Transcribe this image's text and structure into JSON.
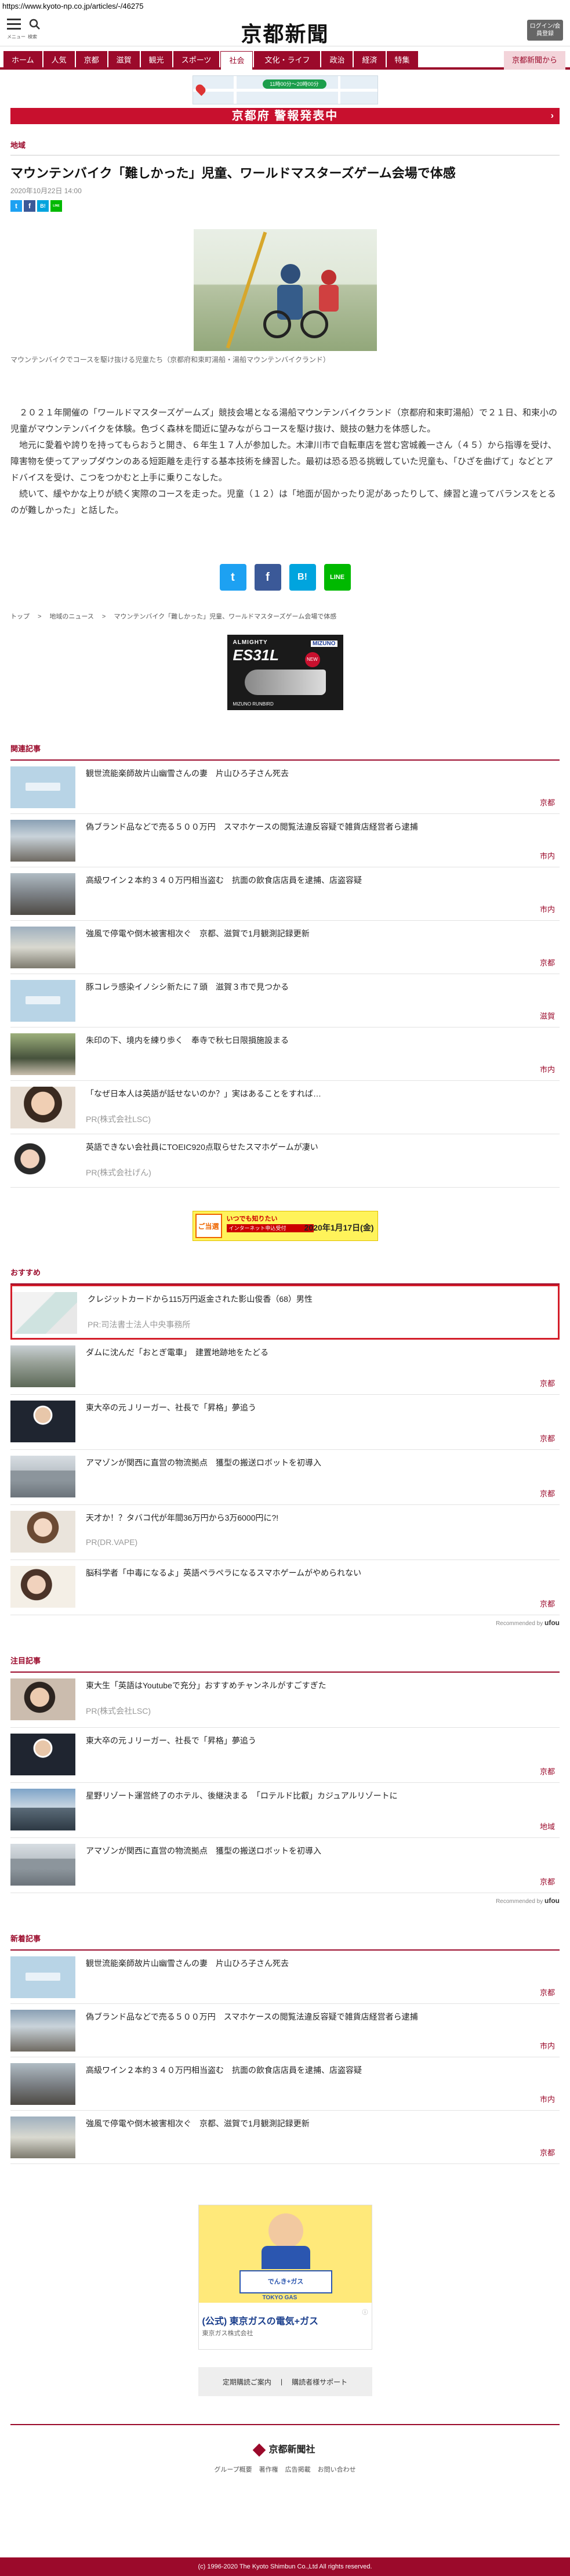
{
  "browser": {
    "url": "https://www.kyoto-np.co.jp/articles/-/46275"
  },
  "header": {
    "menu_label": "メニュー",
    "search_label": "検索",
    "logo": "京都新聞",
    "login_button": "ログイン/会員登録"
  },
  "nav": {
    "items": [
      "ホーム",
      "人気",
      "京都",
      "滋賀",
      "観光",
      "スポーツ",
      "社会",
      "文化・ライフ",
      "政治",
      "経済",
      "特集",
      "京都新聞から"
    ],
    "active_index": 6
  },
  "map_banner": {
    "pill_text": "11時00分〜20時00分"
  },
  "alert": {
    "text": "京都府 警報発表中",
    "arrow": "›"
  },
  "article": {
    "category": "地域",
    "title": "マウンテンバイク「難しかった」児童、ワールドマスターズゲーム会場で体感",
    "date": "2020年10月22日 14:00",
    "caption": "マウンテンバイクでコースを駆け抜ける児童たち（京都府和束町湯船・湯船マウンテンバイクランド）",
    "paragraphs": [
      "２０２１年開催の「ワールドマスターズゲームズ」競技会場となる湯船マウンテンバイクランド（京都府和束町湯船）で２１日、和束小の児童がマウンテンバイクを体験。色づく森林を間近に望みながらコースを駆け抜け、競技の魅力を体感した。",
      "地元に愛着や誇りを持ってもらおうと開き、６年生１７人が参加した。木津川市で自転車店を営む宮城義一さん（４５）から指導を受け、障害物を使ってアップダウンのある短距離を走行する基本技術を練習した。最初は恐る恐る挑戦していた児童も、「ひざを曲げて」などとアドバイスを受け、こつをつかむと上手に乗りこなした。",
      "続いて、緩やかな上りが続く実際のコースを走った。児童（１２）は「地面が固かったり泥があったりして、練習と違ってバランスをとるのが難しかった」と話した。"
    ],
    "breadcrumb": [
      "トップ",
      "地域のニュース",
      "マウンテンバイク「難しかった」児童、ワールドマスターズゲーム会場で体感"
    ]
  },
  "share": {
    "twitter": "t",
    "facebook": "f",
    "hatena": "B!",
    "line": "LINE"
  },
  "ad_shoe": {
    "brand": "ALMIGHTY",
    "model": "ES31L",
    "maker": "MIZUNO",
    "badge": "NEW",
    "slogan": "MIZUNO RUNBIRD"
  },
  "related": {
    "title": "関連記事",
    "items": [
      {
        "title": "観世流能楽師故片山幽雪さんの妻　片山ひろ子さん死去",
        "tag": "京都",
        "thumb": "logo"
      },
      {
        "title": "偽ブランド品などで売る５００万円　スマホケースの閲覧法違反容疑で雑貨店経営者ら逮捕",
        "tag": "市内",
        "thumb": "city"
      },
      {
        "title": "高級ワイン２本約３４０万円相当盗む　抗面の飲食店店員を逮捕、店盗容疑",
        "tag": "市内",
        "thumb": "city2"
      },
      {
        "title": "強風で停電や倒木被害相次ぐ　京都、滋賀で1月観測記録更新",
        "tag": "京都",
        "thumb": "city3"
      },
      {
        "title": "豚コレラ感染イノシシ新たに７頭　滋賀３市で見つかる",
        "tag": "滋賀",
        "thumb": "logo"
      },
      {
        "title": "朱印の下、境内を練り歩く　奉寺で秋七日限損施設まる",
        "tag": "市内",
        "thumb": "people"
      },
      {
        "title": "「なぜ日本人は英語が話せないのか？」実はあることをすれば…",
        "sponsor": "PR(株式会社LSC)",
        "thumb": "face"
      },
      {
        "title": "英語できない会社員にTOEIC920点取らせたスマホゲームが凄い",
        "sponsor": "PR(株式会社げん)",
        "thumb": "face2"
      }
    ]
  },
  "ad_yellow": {
    "line1": "ご当選",
    "line2": "いつでも知りたい",
    "line3": "インターネット申込受付",
    "date": "2020年1月17日(金)"
  },
  "recommend": {
    "title": "おすすめ",
    "items": [
      {
        "title": "クレジットカードから115万円返金された影山俊香（68）男性",
        "sponsor": "PR:司法書士法人中央事務所",
        "thumb": "card",
        "highlight": true
      },
      {
        "title": "ダムに沈んだ「おとぎ電車」　建置地跡地をたどる",
        "tag": "京都",
        "thumb": "dam"
      },
      {
        "title": "東大卒の元Ｊリーガー、社長で「昇格」夢追う",
        "tag": "京都",
        "thumb": "man"
      },
      {
        "title": "アマゾンが関西に直営の物流拠点　獲型の搬送ロボットを初導入",
        "tag": "京都",
        "thumb": "warehouse"
      },
      {
        "title": "天才か！？タバコ代が年間36万円から3万6000円に?!",
        "sponsor": "PR(DR.VAPE)",
        "thumb": "woman"
      },
      {
        "title": "脳科学者「中毒になるよ」英語ペラペラになるスマホゲームがやめられない",
        "tag": "京都",
        "thumb": "face3"
      }
    ],
    "recommended_by": "Recommended by",
    "brand": "ufou"
  },
  "featured": {
    "title": "注目記事",
    "items": [
      {
        "title": "東大生「英語はYoutubeで充分」おすすめチャンネルがすごすぎた",
        "sponsor": "PR(株式会社LSC)",
        "thumb": "face4"
      },
      {
        "title": "東大卒の元Ｊリーガー、社長で「昇格」夢追う",
        "tag": "京都",
        "thumb": "man"
      },
      {
        "title": "星野リゾート運営終了のホテル、後継決まる　「ロテルド比叡」カジュアルリゾートに",
        "tag": "地域",
        "thumb": "hotel"
      },
      {
        "title": "アマゾンが関西に直営の物流拠点　獲型の搬送ロボットを初導入",
        "tag": "京都",
        "thumb": "warehouse"
      }
    ],
    "recommended_by": "Recommended by",
    "brand": "ufou"
  },
  "latest": {
    "title": "新着記事",
    "items": [
      {
        "title": "観世流能楽師故片山幽雪さんの妻　片山ひろ子さん死去",
        "tag": "京都",
        "thumb": "logo"
      },
      {
        "title": "偽ブランド品などで売る５００万円　スマホケースの閲覧法違反容疑で雑貨店経営者ら逮捕",
        "tag": "市内",
        "thumb": "city"
      },
      {
        "title": "高級ワイン２本約３４０万円相当盗む　抗面の飲食店店員を逮捕、店盗容疑",
        "tag": "市内",
        "thumb": "city2"
      },
      {
        "title": "強風で停電や倒木被害相次ぐ　京都、滋賀で1月観測記録更新",
        "tag": "京都",
        "thumb": "city3"
      }
    ]
  },
  "gas_ad": {
    "headline": "(公式) 東京ガスの電気+ガス",
    "sub": "東京ガス株式会社",
    "badge": "でんき+ガス",
    "brand": "TOKYO GAS"
  },
  "footer": {
    "links": [
      "定期購読ご案内",
      "購読者様サポート"
    ],
    "logo": "京都新聞社",
    "nav": [
      "グループ概要",
      "著作権",
      "広告掲載",
      "お問い合わせ"
    ],
    "copyright": "(c) 1996-2020 The Kyoto Shimbun Co.,Ltd All rights reserved."
  },
  "colors": {
    "brand": "#9b0a2b",
    "alert": "#c8102e",
    "twitter": "#1da1f2",
    "facebook": "#3b5998",
    "hatena": "#00a4de",
    "line": "#00b900"
  }
}
